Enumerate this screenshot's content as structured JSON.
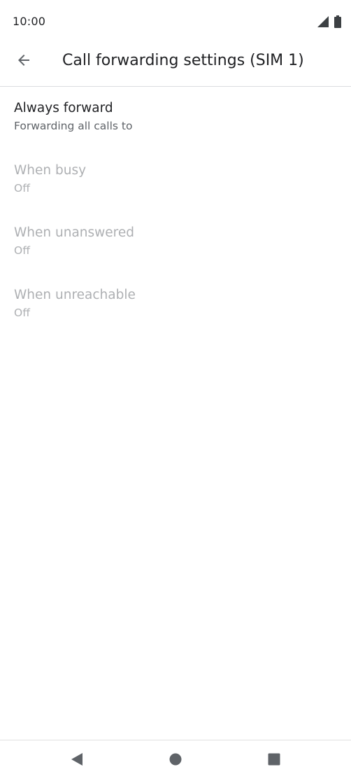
{
  "status_bar": {
    "time": "10:00",
    "icons": [
      "cellular-signal-icon",
      "battery-icon"
    ]
  },
  "app_bar": {
    "back_icon": "arrow-back-icon",
    "title": "Call forwarding settings (SIM 1)"
  },
  "items": [
    {
      "title": "Always forward",
      "summary": "Forwarding all calls to",
      "enabled": true
    },
    {
      "title": "When busy",
      "summary": "Off",
      "enabled": false
    },
    {
      "title": "When unanswered",
      "summary": "Off",
      "enabled": false
    },
    {
      "title": "When unreachable",
      "summary": "Off",
      "enabled": false
    }
  ],
  "nav_bar": {
    "icons": [
      "nav-back-icon",
      "nav-home-icon",
      "nav-recents-icon"
    ]
  },
  "colors": {
    "text_primary": "#202124",
    "text_secondary": "#5f6368",
    "text_disabled": "#aeb0b3",
    "nav_icon": "#5f6368"
  }
}
